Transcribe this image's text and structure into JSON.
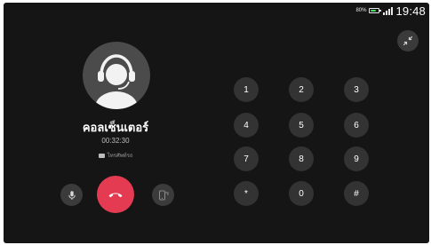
{
  "status_bar": {
    "battery_percent": "80%",
    "battery_level": 0.8,
    "battery_color": "#4cd964",
    "time": "19:48"
  },
  "caller": {
    "name": "คอลเซ็นเตอร์",
    "duration": "00:32:30",
    "sim_label": "โทรศัพท์รถ"
  },
  "controls": {
    "mute_icon": "microphone-icon",
    "end_call_icon": "hang-up-icon",
    "end_call_color": "#e43b53",
    "switch_icon": "transfer-to-phone-icon",
    "minimize_icon": "collapse-arrows-icon"
  },
  "dialpad": {
    "keys": [
      "1",
      "2",
      "3",
      "4",
      "5",
      "6",
      "7",
      "8",
      "9",
      "*",
      "0",
      "#"
    ]
  }
}
